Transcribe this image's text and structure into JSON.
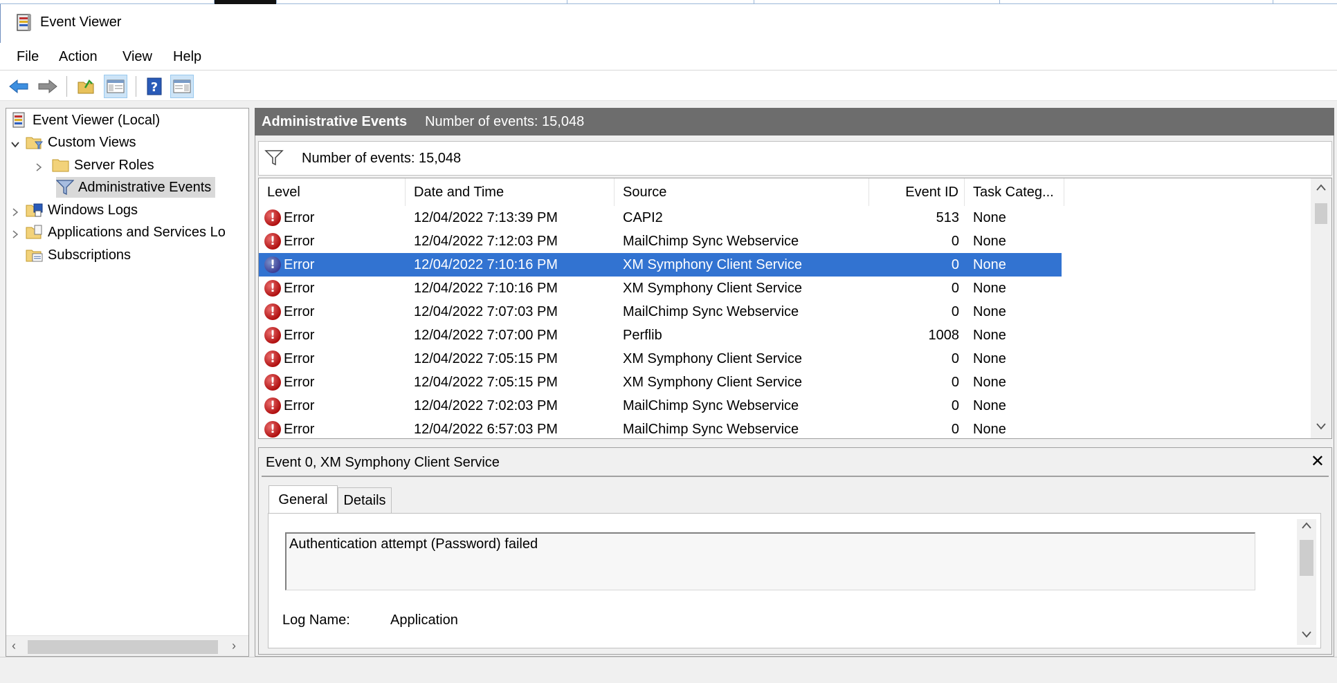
{
  "window": {
    "title": "Event Viewer"
  },
  "menu": [
    "File",
    "Action",
    "View",
    "Help"
  ],
  "toolbar": {
    "buttons": [
      "back-icon",
      "forward-icon",
      "open-folder-icon",
      "show-hide-console-tree-icon",
      "help-icon",
      "show-hide-action-pane-icon"
    ]
  },
  "tree": {
    "root": "Event Viewer (Local)",
    "custom_views": "Custom Views",
    "server_roles": "Server Roles",
    "administrative_events": "Administrative Events",
    "windows_logs": "Windows Logs",
    "apps_services": "Applications and Services Lo",
    "subscriptions": "Subscriptions"
  },
  "pane_header": {
    "title": "Administrative Events",
    "count": "Number of events: 15,048"
  },
  "filter": {
    "text": "Number of events: 15,048"
  },
  "grid": {
    "columns": [
      "Level",
      "Date and Time",
      "Source",
      "Event ID",
      "Task Categ..."
    ],
    "rows": [
      {
        "level": "Error",
        "date": "12/04/2022 7:13:39 PM",
        "source": "CAPI2",
        "event_id": "513",
        "task": "None"
      },
      {
        "level": "Error",
        "date": "12/04/2022 7:12:03 PM",
        "source": "MailChimp Sync Webservice",
        "event_id": "0",
        "task": "None"
      },
      {
        "level": "Error",
        "date": "12/04/2022 7:10:16 PM",
        "source": "XM Symphony Client Service",
        "event_id": "0",
        "task": "None"
      },
      {
        "level": "Error",
        "date": "12/04/2022 7:10:16 PM",
        "source": "XM Symphony Client Service",
        "event_id": "0",
        "task": "None"
      },
      {
        "level": "Error",
        "date": "12/04/2022 7:07:03 PM",
        "source": "MailChimp Sync Webservice",
        "event_id": "0",
        "task": "None"
      },
      {
        "level": "Error",
        "date": "12/04/2022 7:07:00 PM",
        "source": "Perflib",
        "event_id": "1008",
        "task": "None"
      },
      {
        "level": "Error",
        "date": "12/04/2022 7:05:15 PM",
        "source": "XM Symphony Client Service",
        "event_id": "0",
        "task": "None"
      },
      {
        "level": "Error",
        "date": "12/04/2022 7:05:15 PM",
        "source": "XM Symphony Client Service",
        "event_id": "0",
        "task": "None"
      },
      {
        "level": "Error",
        "date": "12/04/2022 7:02:03 PM",
        "source": "MailChimp Sync Webservice",
        "event_id": "0",
        "task": "None"
      },
      {
        "level": "Error",
        "date": "12/04/2022 6:57:03 PM",
        "source": "MailChimp Sync Webservice",
        "event_id": "0",
        "task": "None"
      }
    ],
    "selected_index": 2
  },
  "detail": {
    "title": "Event 0, XM Symphony Client Service",
    "close": "✕",
    "tabs": [
      "General",
      "Details"
    ],
    "message": "Authentication attempt (Password) failed",
    "log_name_label": "Log Name:",
    "log_name_value": "Application"
  },
  "colors": {
    "selection": "#3273d1",
    "header_bar": "#6d6d6d",
    "error_red": "#b01010"
  }
}
